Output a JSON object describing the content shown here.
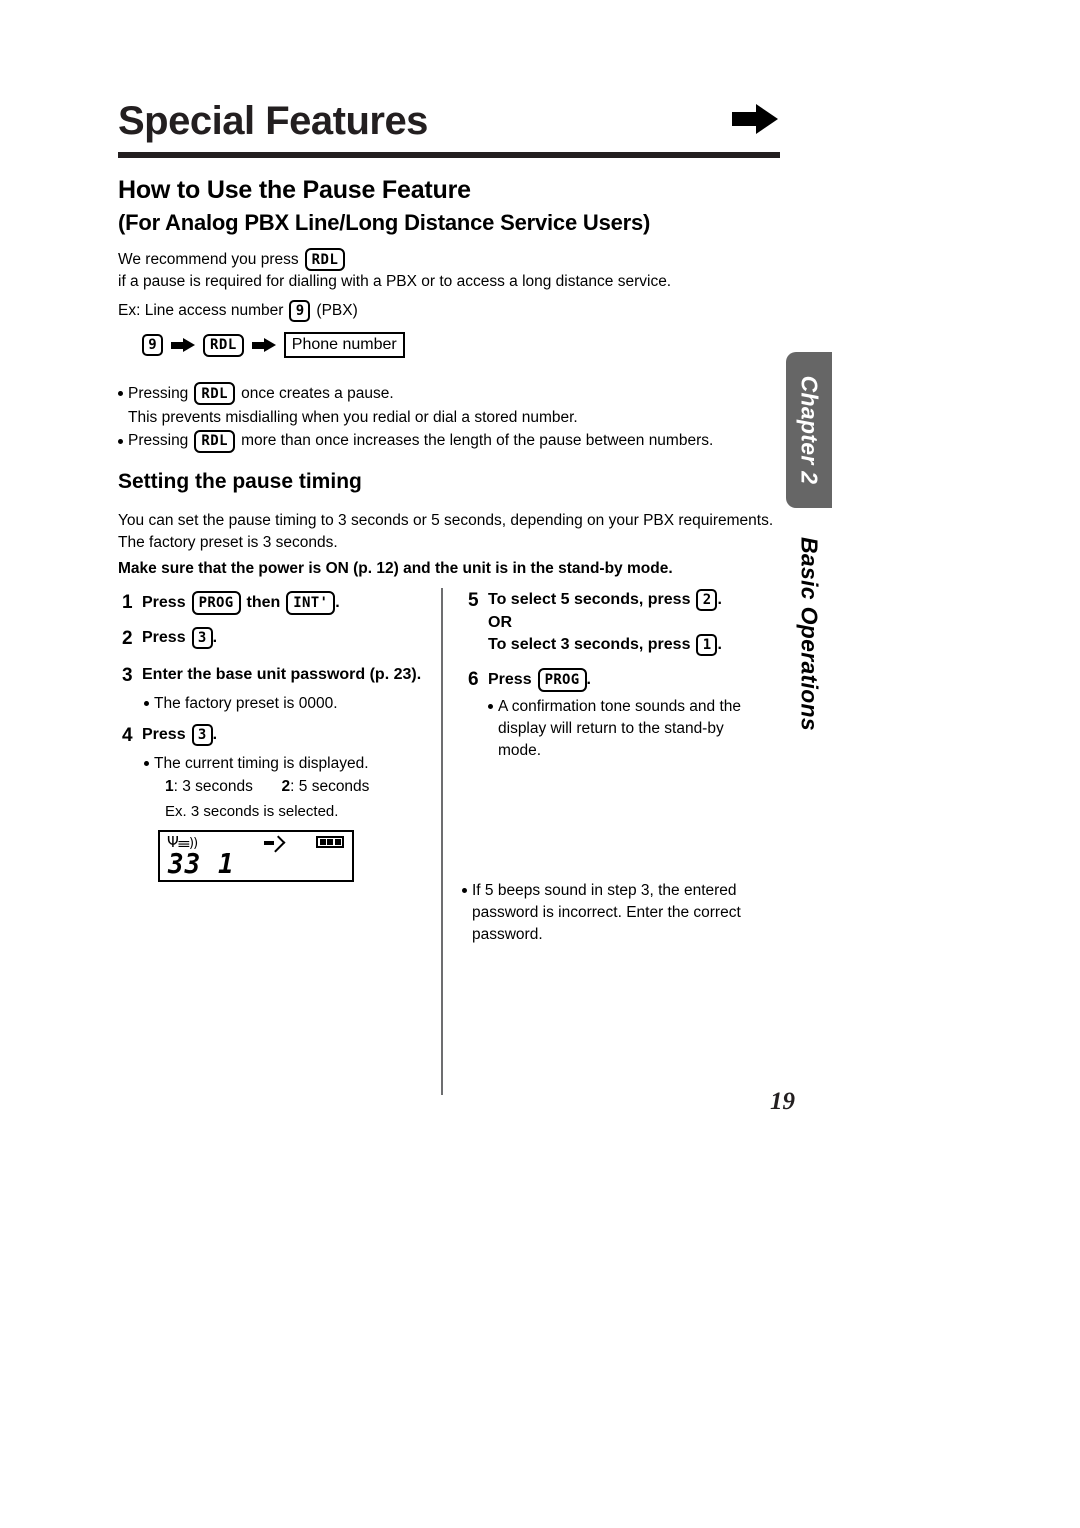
{
  "header": {
    "title": "Special Features",
    "arrow_icon": "right-arrow-icon"
  },
  "headings": {
    "h2": "How to Use the Pause Feature",
    "h3": "(For Analog PBX Line/Long Distance Service Users)",
    "sub": "Setting the pause timing"
  },
  "intro": {
    "part1": "We recommend you press",
    "key_rdl": "RDL",
    "part2": "if a pause is required for dialling with a PBX or to access a long distance service.",
    "ex_label": "Ex: Line access number",
    "ex_key": "9",
    "ex_suffix": "(PBX)"
  },
  "flow": {
    "step1_key": "9",
    "step2_key": "RDL",
    "step3_box": "Phone number",
    "arrow_icon": "flow-arrow-icon"
  },
  "notes": [
    {
      "before": "Pressing",
      "key": "RDL",
      "after": "once creates a pause.",
      "continuation": "This prevents misdialling when you redial or dial a stored number."
    },
    {
      "before": "Pressing",
      "key": "RDL",
      "after": "more than once increases the length of the pause between numbers.",
      "continuation": ""
    }
  ],
  "setting": {
    "paragraph": "You can set the pause timing to 3 seconds or 5 seconds, depending on your PBX requirements. The factory preset is 3 seconds.",
    "bold_line": "Make sure that the power is ON (p. 12) and the unit is in the stand-by mode."
  },
  "steps_left": {
    "step1": {
      "num": "1",
      "text_a": "Press",
      "key_a": "PROG",
      "text_b": "then",
      "key_b": "INT'",
      "text_c": "."
    },
    "step2": {
      "num": "2",
      "text_a": "Press",
      "key_a": "3",
      "text_c": "."
    },
    "step3": {
      "num": "3",
      "text": "Enter the base unit password (p. 23).",
      "note": "The factory preset is 0000."
    },
    "step4": {
      "num": "4",
      "text_a": "Press",
      "key_a": "3",
      "text_c": ".",
      "note": "The current timing is displayed.",
      "timing_1_label": "1",
      "timing_1_value": ": 3 seconds",
      "timing_2_label": "2",
      "timing_2_value": ": 5 seconds",
      "example": "Ex. 3 seconds is selected."
    }
  },
  "steps_right": {
    "step5": {
      "num": "5",
      "line1_a": "To select 5 seconds, press",
      "line1_key": "2",
      "line1_b": ".",
      "or": "OR",
      "line2_a": "To select 3 seconds, press",
      "line2_key": "1",
      "line2_b": "."
    },
    "step6": {
      "num": "6",
      "text_a": "Press",
      "key_a": "PROG",
      "text_c": ".",
      "note": "A confirmation tone sounds and the display will return to the stand-by mode."
    },
    "warning": "If 5 beeps sound in step 3, the entered password is incorrect. Enter the correct password."
  },
  "lcd": {
    "digits": "33  1",
    "antenna_icon": "antenna-signal-icon",
    "arrow_icon": "lcd-arrow-icon",
    "battery_icon": "battery-full-icon"
  },
  "sidebar": {
    "chapter": "Chapter 2",
    "section": "Basic Operations",
    "tab_color": "#666666"
  },
  "page_number": "19"
}
